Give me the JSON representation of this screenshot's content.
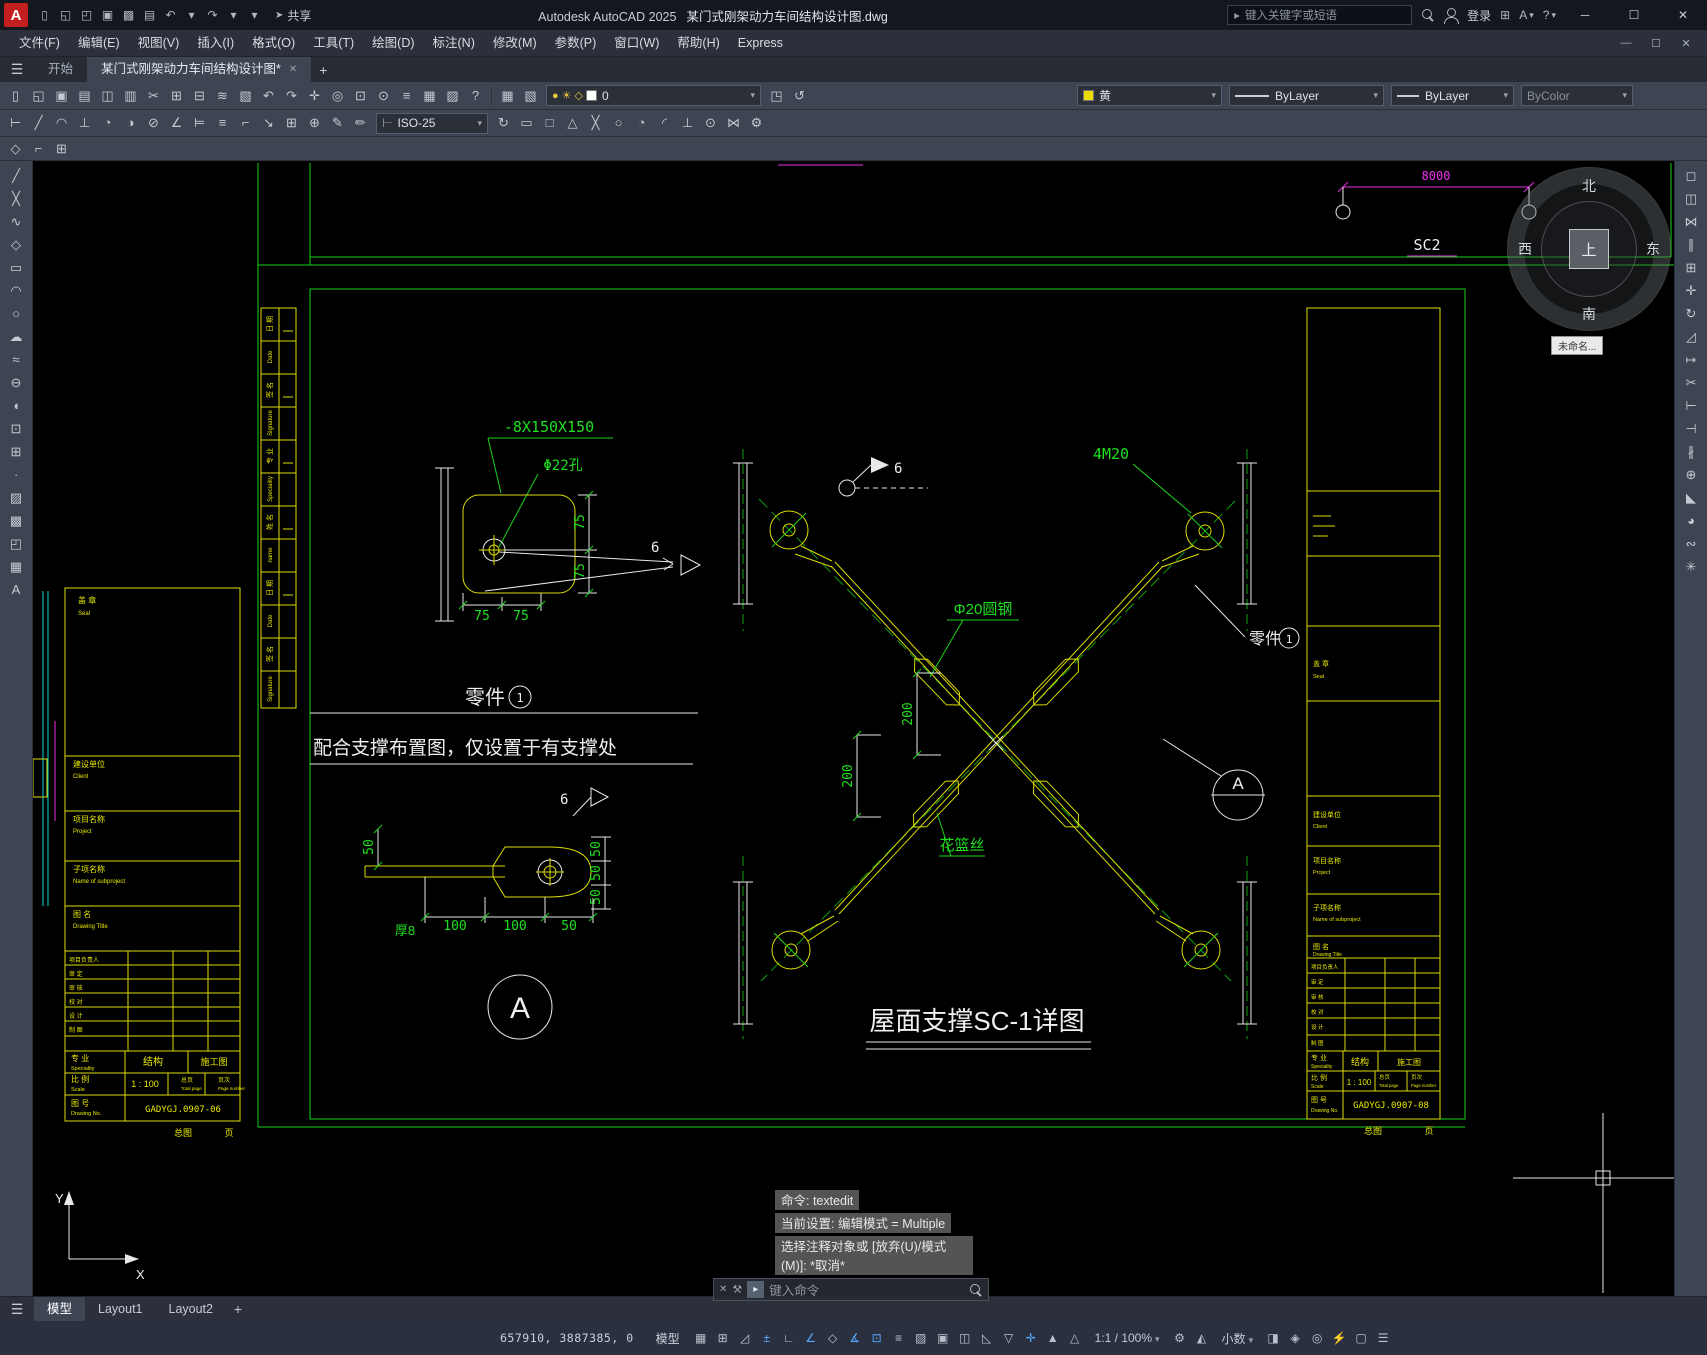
{
  "colors": {
    "cad_green": "#1ad21a",
    "cad_yellow": "#ddde00",
    "cad_white": "#e8e8e8",
    "cad_magenta": "#e830e8",
    "cad_cyan": "#00d8d8",
    "accent_blue": "#55aaff",
    "app_red": "#c21f1f"
  },
  "titlebar": {
    "app_letter": "A",
    "quick_icons": [
      {
        "name": "new-drawing-icon",
        "glyph": "▯"
      },
      {
        "name": "open-drawing-icon",
        "glyph": "◱"
      },
      {
        "name": "open-folder-icon",
        "glyph": "◰"
      },
      {
        "name": "save-icon",
        "glyph": "▣"
      },
      {
        "name": "save-all-icon",
        "glyph": "▩"
      },
      {
        "name": "plot-icon",
        "glyph": "▤"
      },
      {
        "name": "undo-icon",
        "glyph": "↶"
      },
      {
        "name": "undo-dropdown-icon",
        "glyph": "▾"
      },
      {
        "name": "redo-icon",
        "glyph": "↷"
      },
      {
        "name": "redo-dropdown-icon",
        "glyph": "▾"
      },
      {
        "name": "qat-dropdown-icon",
        "glyph": "▾"
      }
    ],
    "share_glyph": "➤",
    "share_label": "共享",
    "app_title": "Autodesk AutoCAD 2025",
    "doc_title": "某门式刚架动力车间结构设计图.dwg",
    "search_prompt_glyph": "▸",
    "search_placeholder": "键入关键字或短语",
    "login_label": "登录",
    "cart_glyph": "⊞",
    "apps_glyph": "A",
    "help_glyph": "?",
    "dropdown_glyph": "▾",
    "window_buttons": {
      "minimize": "─",
      "maximize": "☐",
      "close": "✕"
    }
  },
  "menubar": {
    "items": [
      "文件(F)",
      "编辑(E)",
      "视图(V)",
      "插入(I)",
      "格式(O)",
      "工具(T)",
      "绘图(D)",
      "标注(N)",
      "修改(M)",
      "参数(P)",
      "窗口(W)",
      "帮助(H)",
      "Express"
    ],
    "window_buttons": {
      "minimize": "—",
      "restore": "☐",
      "close": "✕"
    }
  },
  "filetabs": {
    "menu_glyph": "☰",
    "start_tab": "开始",
    "doc_tab": "某门式刚架动力车间结构设计图*",
    "close_glyph": "✕",
    "new_tab_glyph": "+"
  },
  "toolbar1": {
    "left_icons": [
      {
        "name": "new-icon",
        "glyph": "▯"
      },
      {
        "name": "open-icon",
        "glyph": "◱"
      },
      {
        "name": "save-icon",
        "glyph": "▣"
      },
      {
        "name": "plot-icon",
        "glyph": "▤"
      },
      {
        "name": "plot-preview-icon",
        "glyph": "◫"
      },
      {
        "name": "publish-icon",
        "glyph": "▥"
      },
      {
        "name": "cut-icon",
        "glyph": "✂"
      },
      {
        "name": "copy-icon",
        "glyph": "⊞"
      },
      {
        "name": "paste-icon",
        "glyph": "⊟"
      },
      {
        "name": "match-properties-icon",
        "glyph": "≋"
      },
      {
        "name": "block-editor-icon",
        "glyph": "▧"
      },
      {
        "name": "undo-icon",
        "glyph": "↶"
      },
      {
        "name": "redo-icon",
        "glyph": "↷"
      },
      {
        "name": "pan-icon",
        "glyph": "✛"
      },
      {
        "name": "zoom-realtime-icon",
        "glyph": "◎"
      },
      {
        "name": "zoom-window-icon",
        "glyph": "⊡"
      },
      {
        "name": "zoom-previous-icon",
        "glyph": "⊙"
      },
      {
        "name": "properties-icon",
        "glyph": "≡"
      },
      {
        "name": "design-center-icon",
        "glyph": "▦"
      },
      {
        "name": "tool-palettes-icon",
        "glyph": "▨"
      },
      {
        "name": "help-icon",
        "glyph": "?"
      }
    ],
    "layer_icons": [
      {
        "name": "layer-properties-manager-icon",
        "glyph": "▦"
      },
      {
        "name": "layer-states-icon",
        "glyph": "▧"
      }
    ],
    "layer_combo": {
      "on_glyph": "●",
      "sun_glyph": "☀",
      "lock_glyph": "◇",
      "value": "0"
    },
    "layer_post_icons": [
      {
        "name": "make-object-layer-current-icon",
        "glyph": "◳"
      },
      {
        "name": "layer-previous-icon",
        "glyph": "↺"
      }
    ],
    "color_combo": {
      "value": "黄",
      "swatch": "#e8dc00"
    },
    "linetype_combo": {
      "value": "ByLayer"
    },
    "lineweight_combo": {
      "value": "ByLayer"
    },
    "plotstyle_combo": {
      "value": "ByColor"
    }
  },
  "toolbar2": {
    "icons_a": [
      {
        "name": "linear-dimension-icon",
        "glyph": "⊢"
      },
      {
        "name": "aligned-dimension-icon",
        "glyph": "╱"
      },
      {
        "name": "arc-length-dimension-icon",
        "glyph": "◠"
      },
      {
        "name": "ordinate-dimension-icon",
        "glyph": "⊥"
      },
      {
        "name": "radius-dimension-icon",
        "glyph": "◔"
      },
      {
        "name": "jogged-dimension-icon",
        "glyph": "◑"
      },
      {
        "name": "diameter-dimension-icon",
        "glyph": "⊘"
      },
      {
        "name": "angular-dimension-icon",
        "glyph": "∠"
      },
      {
        "name": "quick-dimension-icon",
        "glyph": "⊨"
      },
      {
        "name": "baseline-dimension-icon",
        "glyph": "≡"
      },
      {
        "name": "continue-dimension-icon",
        "glyph": "⌐"
      },
      {
        "name": "leader-icon",
        "glyph": "↘"
      },
      {
        "name": "tolerance-icon",
        "glyph": "⊞"
      },
      {
        "name": "center-mark-icon",
        "glyph": "⊕"
      },
      {
        "name": "dimension-edit-icon",
        "glyph": "✎"
      },
      {
        "name": "dimension-text-edit-icon",
        "glyph": "✏"
      }
    ],
    "style_combo": {
      "icon_glyph": "⊢",
      "value": "ISO-25"
    },
    "icons_b": [
      {
        "name": "dimension-update-icon",
        "glyph": "↻"
      },
      {
        "name": "dimension-style-icon",
        "glyph": "▭"
      },
      {
        "name": "snap-endpoint-icon",
        "glyph": "□"
      },
      {
        "name": "snap-midpoint-icon",
        "glyph": "△"
      },
      {
        "name": "snap-intersection-icon",
        "glyph": "╳"
      },
      {
        "name": "snap-center-icon",
        "glyph": "○"
      },
      {
        "name": "snap-quadrant-icon",
        "glyph": "◔"
      },
      {
        "name": "snap-tangent-icon",
        "glyph": "◜"
      },
      {
        "name": "snap-perpendicular-icon",
        "glyph": "⊥"
      },
      {
        "name": "snap-node-icon",
        "glyph": "⊙"
      },
      {
        "name": "snap-nearest-icon",
        "glyph": "⋈"
      },
      {
        "name": "osnap-settings-icon",
        "glyph": "⚙"
      }
    ]
  },
  "toolbar3": {
    "icons": [
      {
        "name": "snap-from-icon",
        "glyph": "◇"
      },
      {
        "name": "measure-icon",
        "glyph": "⌐"
      },
      {
        "name": "quick-calc-icon",
        "glyph": "⊞"
      }
    ]
  },
  "draw_toolbar": [
    {
      "name": "line-icon",
      "glyph": "╱"
    },
    {
      "name": "construction-line-icon",
      "glyph": "╳"
    },
    {
      "name": "polyline-icon",
      "glyph": "∿"
    },
    {
      "name": "polygon-icon",
      "glyph": "◇"
    },
    {
      "name": "rectangle-icon",
      "glyph": "▭"
    },
    {
      "name": "arc-icon",
      "glyph": "◠"
    },
    {
      "name": "circle-icon",
      "glyph": "○"
    },
    {
      "name": "revision-cloud-icon",
      "glyph": "☁"
    },
    {
      "name": "spline-icon",
      "glyph": "≈"
    },
    {
      "name": "ellipse-icon",
      "glyph": "⊖"
    },
    {
      "name": "ellipse-arc-icon",
      "glyph": "◖"
    },
    {
      "name": "insert-block-icon",
      "glyph": "⊡"
    },
    {
      "name": "create-block-icon",
      "glyph": "⊞"
    },
    {
      "name": "point-icon",
      "glyph": "∙"
    },
    {
      "name": "hatch-icon",
      "glyph": "▨"
    },
    {
      "name": "gradient-icon",
      "glyph": "▩"
    },
    {
      "name": "region-icon",
      "glyph": "◰"
    },
    {
      "name": "table-icon",
      "glyph": "▦"
    },
    {
      "name": "multiline-text-icon",
      "glyph": "A"
    }
  ],
  "modify_toolbar": [
    {
      "name": "erase-icon",
      "glyph": "◻"
    },
    {
      "name": "copy-icon",
      "glyph": "◫"
    },
    {
      "name": "mirror-icon",
      "glyph": "⋈"
    },
    {
      "name": "offset-icon",
      "glyph": "∥"
    },
    {
      "name": "array-icon",
      "glyph": "⊞"
    },
    {
      "name": "move-icon",
      "glyph": "✛"
    },
    {
      "name": "rotate-icon",
      "glyph": "↻"
    },
    {
      "name": "scale-icon",
      "glyph": "◿"
    },
    {
      "name": "stretch-icon",
      "glyph": "↦"
    },
    {
      "name": "trim-icon",
      "glyph": "✂"
    },
    {
      "name": "extend-icon",
      "glyph": "⊢"
    },
    {
      "name": "break-at-point-icon",
      "glyph": "⊣"
    },
    {
      "name": "break-icon",
      "glyph": "∦"
    },
    {
      "name": "join-icon",
      "glyph": "⊕"
    },
    {
      "name": "chamfer-icon",
      "glyph": "◣"
    },
    {
      "name": "fillet-icon",
      "glyph": "◕"
    },
    {
      "name": "blend-curves-icon",
      "glyph": "∾"
    },
    {
      "name": "explode-icon",
      "glyph": "✳"
    }
  ],
  "canvas": {
    "top": {
      "dim": "8000",
      "sc2": "SC2"
    },
    "compass": {
      "n": "北",
      "s": "南",
      "e": "东",
      "w": "西",
      "up": "上",
      "tooltip": "未命名..."
    },
    "side_cells": [
      "日 期",
      "Date",
      "签 名",
      "Signature",
      "专 业",
      "Speciality",
      "姓 名",
      "name",
      "日 期",
      "Date",
      "签 名",
      "Signature"
    ],
    "plate": {
      "callout": "-8X150X150",
      "hole": "Φ22孔",
      "d75": "75",
      "sec": "6",
      "part": "零件",
      "part_no": "1",
      "note": "配合支撑布置图，仅设置于有支撑处"
    },
    "gusset": {
      "sec": "6",
      "d50": "50",
      "d100": "100",
      "thick": "厚8",
      "bubble": "A"
    },
    "brace": {
      "bolt": "4M20",
      "rod": "Φ20圆钢",
      "tb": "花篮丝",
      "d200": "200",
      "part": "零件",
      "part_no": "1",
      "detail": "A",
      "sec": "6",
      "title": "屋面支撑SC-1详图"
    },
    "tb": {
      "seal": "盖 章",
      "seal_en": "Seal",
      "client": "建设单位",
      "client_en": "Client",
      "project": "项目名称",
      "project_en": "Project",
      "subproject": "子项名称",
      "subproject_en": "Name of subproject",
      "dtitle": "图 名",
      "dtitle_en": "Drawing Title",
      "staff": [
        "项目负责人",
        "审 定",
        "审 核",
        "校 对",
        "设 计",
        "制 图"
      ],
      "spec": "专 业",
      "spec_en": "Speciality",
      "spec_val": "结构",
      "status_val": "施工图",
      "scale": "比 例",
      "scale_en": "Scale",
      "scale_val": "1 : 100",
      "total": "总页",
      "total_en": "Total page",
      "page": "页次",
      "page_en": "Page number",
      "no": "图 号",
      "no_en": "Drawing No.",
      "no_left": "GADYGJ.0907-06",
      "no_right": "GADYGJ.0907-08",
      "footer_a": "总图",
      "footer_b": "页"
    }
  },
  "cmd": {
    "history": [
      "命令:  textedit",
      "当前设置: 编辑模式 = Multiple",
      "选择注释对象或 [放弃(U)/模式(M)]: *取消*"
    ],
    "close_glyph": "✕",
    "wrench_glyph": "⚒",
    "badge_glyph": "▸",
    "input_placeholder": "键入命令"
  },
  "bottom_tabs": {
    "menu_glyph": "☰",
    "tabs": [
      {
        "label": "模型",
        "active": true
      },
      {
        "label": "Layout1",
        "active": false
      },
      {
        "label": "Layout2",
        "active": false
      }
    ],
    "add_glyph": "+"
  },
  "statusbar": {
    "coords": "657910, 3887385, 0",
    "model_label": "模型",
    "icons_a": [
      {
        "name": "grid-icon",
        "glyph": "▦",
        "active": false
      },
      {
        "name": "snap-mode-icon",
        "glyph": "⊞",
        "active": false
      },
      {
        "name": "infer-constraints-icon",
        "glyph": "◿",
        "active": false
      },
      {
        "name": "dynamic-input-icon",
        "glyph": "±",
        "active": true
      },
      {
        "name": "ortho-mode-icon",
        "glyph": "∟",
        "active": false
      },
      {
        "name": "polar-tracking-icon",
        "glyph": "∠",
        "active": true
      },
      {
        "name": "isometric-drafting-icon",
        "glyph": "◇",
        "active": false
      },
      {
        "name": "osnap-tracking-icon",
        "glyph": "∡",
        "active": true
      },
      {
        "name": "object-snap-icon",
        "glyph": "⊡",
        "active": true
      },
      {
        "name": "lineweight-display-icon",
        "glyph": "≡",
        "active": false
      },
      {
        "name": "transparency-icon",
        "glyph": "▨",
        "active": false
      },
      {
        "name": "selection-cycling-icon",
        "glyph": "▣",
        "active": false
      },
      {
        "name": "object-snap-3d-icon",
        "glyph": "◫",
        "active": false
      },
      {
        "name": "dynamic-ucs-icon",
        "glyph": "◺",
        "active": false
      },
      {
        "name": "selection-filtering-icon",
        "glyph": "▽",
        "active": false
      },
      {
        "name": "gizmo-icon",
        "glyph": "✛",
        "active": true
      },
      {
        "name": "annotation-visibility-icon",
        "glyph": "▲",
        "active": false
      },
      {
        "name": "autoscale-icon",
        "glyph": "△",
        "active": false
      }
    ],
    "scale_display": "1:1 / 100%",
    "icons_b": [
      {
        "name": "workspace-switching-icon",
        "glyph": "⚙",
        "active": false
      },
      {
        "name": "annotation-monitor-icon",
        "glyph": "◭",
        "active": false
      }
    ],
    "units_display": "小数",
    "icons_c": [
      {
        "name": "quick-properties-icon",
        "glyph": "◨",
        "active": false
      },
      {
        "name": "lock-ui-icon",
        "glyph": "◈",
        "active": false
      },
      {
        "name": "isolate-objects-icon",
        "glyph": "◎",
        "active": false
      },
      {
        "name": "hardware-acceleration-icon",
        "glyph": "⚡",
        "active": true
      },
      {
        "name": "clean-screen-icon",
        "glyph": "▢",
        "active": false
      },
      {
        "name": "customization-icon",
        "glyph": "☰",
        "active": false
      }
    ],
    "dropdown_glyph": "▾"
  }
}
